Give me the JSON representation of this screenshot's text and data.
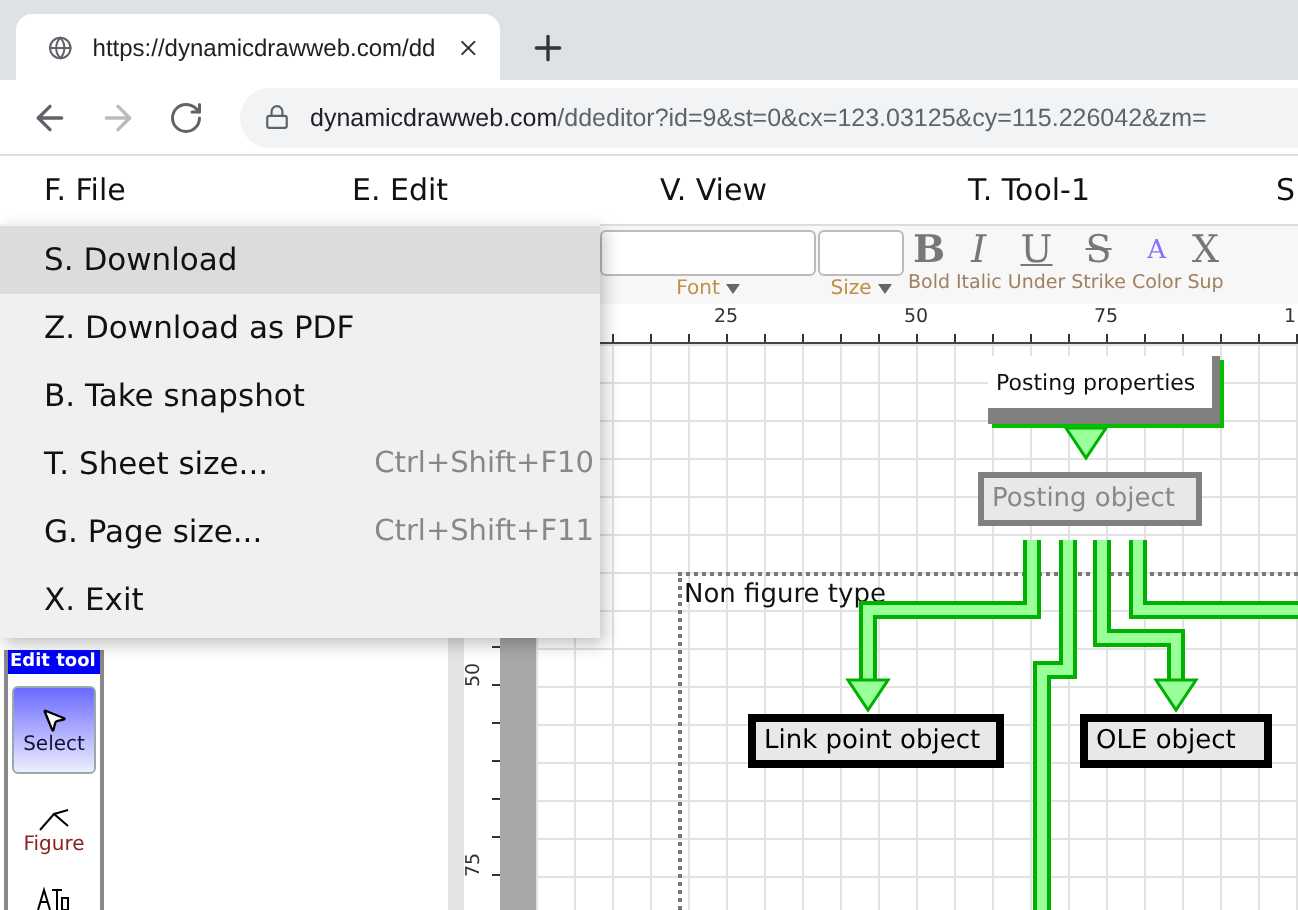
{
  "browser": {
    "tab_title": "https://dynamicdrawweb.com/dd",
    "url_domain": "dynamicdrawweb.com",
    "url_path": "/ddeditor?id=9&st=0&cx=123.03125&cy=115.226042&zm="
  },
  "menu_bar": [
    "F. File",
    "E. Edit",
    "V. View",
    "T. Tool-1",
    "S"
  ],
  "file_menu": [
    {
      "label": "S. Download",
      "selected": true
    },
    {
      "label": "Z. Download as PDF",
      "selected": false
    },
    {
      "label": "B. Take snapshot",
      "selected": false
    },
    {
      "label": "T. Sheet size...",
      "shortcut": "Ctrl+Shift+F10",
      "selected": false
    },
    {
      "label": "G. Page size...",
      "shortcut": "Ctrl+Shift+F11",
      "selected": false
    },
    {
      "label": "X. Exit",
      "selected": false
    }
  ],
  "toolbar": {
    "font_label": "Font",
    "size_label": "Size",
    "buttons": [
      {
        "kind": "bold",
        "glyph": "B",
        "label": "Bold"
      },
      {
        "kind": "italic",
        "glyph": "I",
        "label": "Italic"
      },
      {
        "kind": "underline",
        "glyph": "U",
        "label": "Under"
      },
      {
        "kind": "strike",
        "glyph": "S",
        "label": "Strike"
      },
      {
        "kind": "color",
        "glyph": "A",
        "label": "Color"
      },
      {
        "kind": "superscript",
        "glyph": "X",
        "label": "Sup"
      }
    ]
  },
  "rulers": {
    "horizontal": [
      "25",
      "50",
      "75",
      "1"
    ],
    "vertical": [
      "50",
      "75"
    ]
  },
  "edit_tools": {
    "title": "Edit tool",
    "tools": [
      {
        "kind": "select",
        "label": "Select",
        "selected": true
      },
      {
        "kind": "figure",
        "label": "Figure",
        "selected": false
      }
    ]
  },
  "canvas": {
    "frame_label": "Non figure type",
    "objects": [
      {
        "kind": "property",
        "label": "Posting properties"
      },
      {
        "kind": "template",
        "label": "Posting object"
      },
      {
        "kind": "object",
        "label": "Link point object"
      },
      {
        "kind": "object",
        "label": "OLE object"
      }
    ]
  }
}
